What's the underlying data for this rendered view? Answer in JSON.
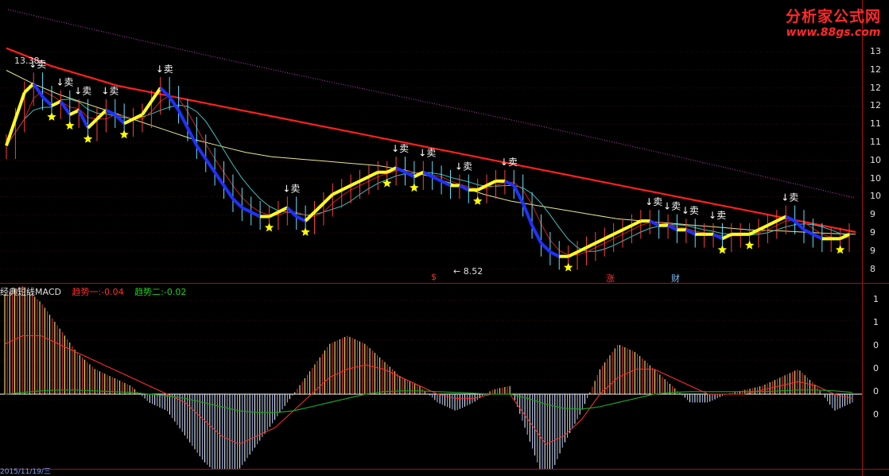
{
  "logo": {
    "brand": "分析家公式网",
    "url": "www.88gs.com"
  },
  "price_panel": {
    "y_ticks": [
      "13",
      "12",
      "12",
      "12",
      "11",
      "11",
      "10",
      "10",
      "10",
      "9",
      "9",
      "9",
      "8"
    ],
    "high_label": "13.38",
    "low_label": "8.52",
    "sell_label": "卖",
    "event_tags": [
      {
        "text": "$",
        "color": "#ff3030"
      },
      {
        "text": "涨",
        "color": "#ff3030"
      },
      {
        "text": "财",
        "color": "#7fbfff"
      }
    ]
  },
  "macd_panel": {
    "title": "经典短线MACD",
    "trend1_label": "趋势一:",
    "trend1_value": "-0.04",
    "trend2_label": "趋势二:",
    "trend2_value": "-0.02",
    "y_ticks": [
      "1",
      "1",
      "0",
      "0",
      "0",
      "0"
    ]
  },
  "date_axis": {
    "first_label": "2015/11/19/三"
  },
  "colors": {
    "ma_long": "#ff2020",
    "ma_dotted": "#c040c0",
    "ma_mid": "#e8e890",
    "ma_short": "#40c0c0",
    "ma_fast": "#d02020",
    "buy_band": "#ffff20",
    "sell_band": "#2030ff",
    "star": "#ffff00",
    "macd_pos": "#ff3030",
    "macd_pos_light": "#ffff80",
    "macd_neg": "#a0c0ff",
    "macd_neg_light": "#ffffff",
    "dea_line": "#20a020",
    "dif_line": "#ff3030"
  },
  "chart_data": {
    "type": "line",
    "title": "",
    "y_range": [
      8.3,
      13.5
    ],
    "close": [
      11.2,
      11.8,
      12.4,
      12.6,
      12.3,
      12.1,
      12.2,
      11.9,
      12.0,
      11.6,
      11.8,
      12.0,
      11.9,
      11.7,
      11.8,
      11.9,
      12.2,
      12.5,
      12.3,
      12.0,
      11.6,
      11.2,
      10.9,
      10.6,
      10.3,
      10.0,
      9.8,
      9.7,
      9.6,
      9.6,
      9.7,
      9.8,
      9.6,
      9.5,
      9.7,
      9.9,
      10.1,
      10.2,
      10.3,
      10.4,
      10.5,
      10.6,
      10.6,
      10.7,
      10.6,
      10.5,
      10.6,
      10.5,
      10.4,
      10.3,
      10.3,
      10.2,
      10.2,
      10.3,
      10.4,
      10.4,
      10.3,
      9.9,
      9.4,
      9.0,
      8.8,
      8.7,
      8.7,
      8.8,
      8.9,
      9.0,
      9.1,
      9.2,
      9.3,
      9.4,
      9.5,
      9.5,
      9.4,
      9.4,
      9.3,
      9.3,
      9.2,
      9.2,
      9.2,
      9.1,
      9.2,
      9.2,
      9.2,
      9.3,
      9.4,
      9.5,
      9.6,
      9.5,
      9.3,
      9.2,
      9.1,
      9.1,
      9.1,
      9.2
    ],
    "ma_long": [
      13.4,
      13.2,
      13.0,
      12.85,
      12.7,
      12.55,
      12.45,
      12.35,
      12.25,
      12.15,
      12.05,
      11.95,
      11.85,
      11.75,
      11.65,
      11.55,
      11.45,
      11.35,
      11.25,
      11.15,
      11.05,
      10.95,
      10.85,
      10.75,
      10.65,
      10.55,
      10.45,
      10.35,
      10.25,
      10.15,
      10.05,
      9.95,
      9.85,
      9.75,
      9.65,
      9.55,
      9.45,
      9.35,
      9.25
    ],
    "ma_mid": [
      12.9,
      12.6,
      12.35,
      12.15,
      11.95,
      11.75,
      11.55,
      11.35,
      11.2,
      11.05,
      10.95,
      10.9,
      10.85,
      10.8,
      10.75,
      10.65,
      10.5,
      10.3,
      10.1,
      9.95,
      9.85,
      9.75,
      9.65,
      9.55,
      9.5,
      9.45,
      9.4,
      9.35,
      9.3,
      9.28,
      9.25,
      9.22,
      9.2
    ],
    "macd": [
      1.2,
      1.3,
      1.1,
      0.8,
      0.5,
      0.3,
      0.2,
      0.1,
      -0.1,
      -0.2,
      -0.5,
      -0.8,
      -1.0,
      -0.9,
      -0.6,
      -0.3,
      0.0,
      0.3,
      0.6,
      0.7,
      0.6,
      0.4,
      0.2,
      0.1,
      -0.1,
      -0.2,
      -0.1,
      0.05,
      0.1,
      -0.5,
      -1.1,
      -0.6,
      -0.2,
      0.3,
      0.6,
      0.5,
      0.3,
      0.1,
      -0.1,
      -0.1,
      0.0,
      0.05,
      0.1,
      0.2,
      0.3,
      0.1,
      -0.2,
      -0.1
    ],
    "dif": [
      0.6,
      0.7,
      0.7,
      0.6,
      0.5,
      0.4,
      0.3,
      0.2,
      0.1,
      0.0,
      -0.1,
      -0.3,
      -0.5,
      -0.6,
      -0.5,
      -0.4,
      -0.2,
      0.0,
      0.2,
      0.3,
      0.35,
      0.3,
      0.2,
      0.1,
      0.0,
      -0.05,
      -0.05,
      0.0,
      0.0,
      -0.3,
      -0.6,
      -0.5,
      -0.3,
      0.0,
      0.2,
      0.3,
      0.3,
      0.2,
      0.1,
      0.0,
      0.0,
      0.0,
      0.05,
      0.1,
      0.15,
      0.1,
      0.0,
      -0.05
    ],
    "dea": [
      0.0,
      0.02,
      0.04,
      0.05,
      0.05,
      0.04,
      0.03,
      0.02,
      0.0,
      -0.02,
      -0.05,
      -0.1,
      -0.15,
      -0.2,
      -0.22,
      -0.22,
      -0.2,
      -0.15,
      -0.1,
      -0.05,
      0.0,
      0.03,
      0.04,
      0.04,
      0.03,
      0.02,
      0.01,
      0.0,
      0.0,
      -0.05,
      -0.12,
      -0.17,
      -0.18,
      -0.15,
      -0.1,
      -0.05,
      0.0,
      0.02,
      0.03,
      0.03,
      0.03,
      0.03,
      0.03,
      0.04,
      0.05,
      0.05,
      0.04,
      0.02
    ]
  }
}
